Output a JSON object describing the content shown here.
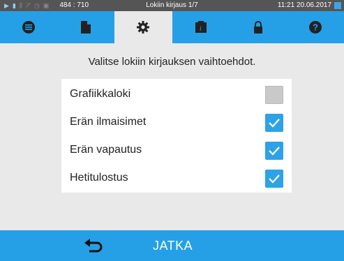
{
  "status_bar": {
    "coords": "484 : 710",
    "title": "Lokiin kirjaus 1/7",
    "datetime": "11:21  20.06.2017",
    "icons": [
      "play-icon",
      "file-icon",
      "signal-icon",
      "chart-icon",
      "clock-icon",
      "lock-icon"
    ]
  },
  "tabs": [
    {
      "icon": "list-icon",
      "active": false
    },
    {
      "icon": "document-icon",
      "active": false
    },
    {
      "icon": "gear-icon",
      "active": true
    },
    {
      "icon": "info-document-icon",
      "active": false
    },
    {
      "icon": "lock-icon",
      "active": false
    },
    {
      "icon": "help-icon",
      "active": false
    }
  ],
  "instruction": "Valitse lokiin kirjauksen vaihtoehdot.",
  "options": [
    {
      "label": "Grafiikkaloki",
      "checked": false
    },
    {
      "label": "Erän ilmaisimet",
      "checked": true
    },
    {
      "label": "Erän vapautus",
      "checked": true
    },
    {
      "label": "Hetitulostus",
      "checked": true
    }
  ],
  "footer": {
    "back_icon": "back-arrow-icon",
    "continue_label": "JATKA"
  },
  "colors": {
    "accent": "#25a0e6",
    "background": "#e9e9e9",
    "status_bar": "#555555",
    "checkbox_checked": "#2ea2e6",
    "checkbox_unchecked": "#c9c9c9"
  }
}
